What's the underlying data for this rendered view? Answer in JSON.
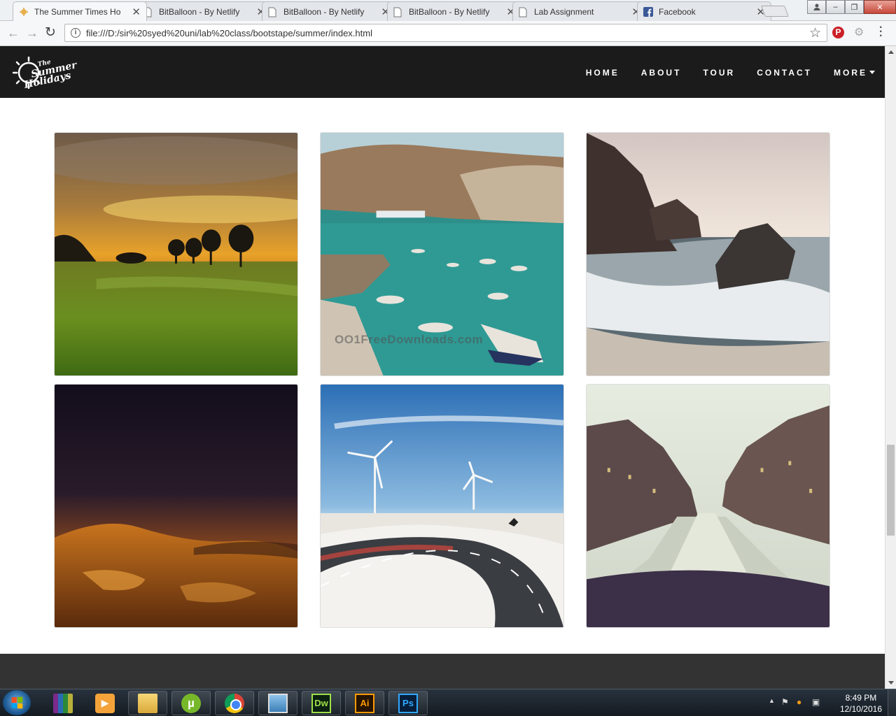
{
  "browser": {
    "tabs": [
      {
        "label": "The Summer Times Ho",
        "icon": "sun-favicon-icon",
        "active": true
      },
      {
        "label": "BitBalloon - By Netlify",
        "icon": "page-icon",
        "active": false
      },
      {
        "label": "BitBalloon - By Netlify",
        "icon": "page-icon",
        "active": false
      },
      {
        "label": "BitBalloon - By Netlify",
        "icon": "page-icon",
        "active": false
      },
      {
        "label": "Lab Assignment",
        "icon": "page-icon",
        "active": false
      },
      {
        "label": "Facebook",
        "icon": "facebook-icon",
        "active": false
      }
    ],
    "url": "file:///D:/sir%20syed%20uni/lab%20class/bootstape/summer/index.html"
  },
  "site": {
    "logo": {
      "line1": "The",
      "line2": "Summer",
      "line3": "Holidays"
    },
    "nav": [
      {
        "label": "HOME"
      },
      {
        "label": "ABOUT"
      },
      {
        "label": "TOUR"
      },
      {
        "label": "CONTACT"
      },
      {
        "label": "MORE",
        "dropdown": true
      }
    ],
    "gallery": [
      {
        "subject": "sunset over green field with trees"
      },
      {
        "subject": "turquoise bay with boats and rocky hills",
        "watermark": "OO1FreeDownloads.com"
      },
      {
        "subject": "waves crashing on rocky shore"
      },
      {
        "subject": "desert dunes at dusk"
      },
      {
        "subject": "road with wind turbines"
      },
      {
        "subject": "city canal at evening"
      }
    ]
  },
  "taskbar": {
    "apps": [
      {
        "name": "winrar",
        "label": ""
      },
      {
        "name": "media-player",
        "label": "▶"
      },
      {
        "name": "file-explorer",
        "label": ""
      },
      {
        "name": "utorrent",
        "label": "µ"
      },
      {
        "name": "chrome",
        "label": ""
      },
      {
        "name": "photo-viewer",
        "label": ""
      },
      {
        "name": "dreamweaver",
        "label": "Dw"
      },
      {
        "name": "illustrator",
        "label": "Ai"
      },
      {
        "name": "photoshop",
        "label": "Ps"
      }
    ],
    "clock": {
      "time": "8:49 PM",
      "date": "12/10/2016"
    }
  },
  "colors": {
    "navbar_bg": "#1b1b1b",
    "footer_bg": "#333333",
    "taskbar_bg": "#1d2630"
  }
}
